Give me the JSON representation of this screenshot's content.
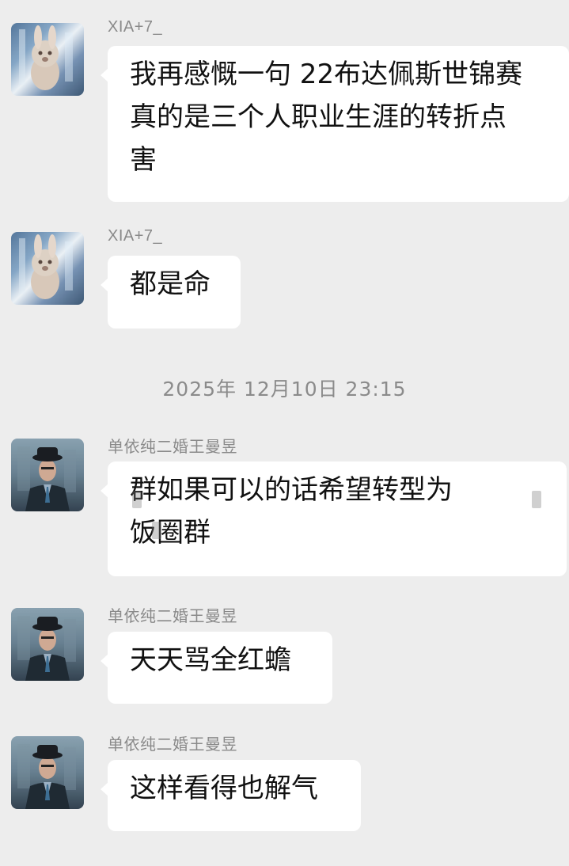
{
  "colors": {
    "background": "#ededed",
    "bubble": "#ffffff",
    "sender_name": "#8a8a8a",
    "timestamp": "#8b8b8b",
    "text": "#111111"
  },
  "timestamp": "2025年 12月10日 23:15",
  "messages": [
    {
      "sender": "XIA+7_",
      "avatar_icon": "rabbit-avatar-icon",
      "text": "我再感慨一句 22布达佩斯世锦赛\n真的是三个人职业生涯的转折点\n害"
    },
    {
      "sender": "XIA+7_",
      "avatar_icon": "rabbit-avatar-icon",
      "text": "都是命"
    },
    {
      "sender": "单依纯二婚王曼昱",
      "avatar_icon": "man-in-hat-avatar-icon",
      "text": "群如果可以的话希望转型为\n饭圈群"
    },
    {
      "sender": "单依纯二婚王曼昱",
      "avatar_icon": "man-in-hat-avatar-icon",
      "text": "天天骂全红蟾"
    },
    {
      "sender": "单依纯二婚王曼昱",
      "avatar_icon": "man-in-hat-avatar-icon",
      "text": "这样看得也解气"
    }
  ]
}
